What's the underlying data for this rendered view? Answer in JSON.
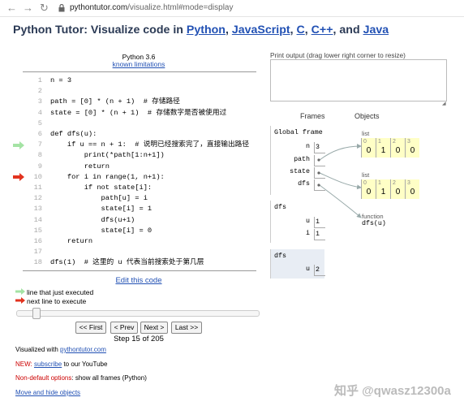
{
  "browser": {
    "url_host": "pythontutor.com",
    "url_path": "/visualize.html#mode=display"
  },
  "header": {
    "title_prefix": "Python Tutor: Visualize code in ",
    "lang_python": "Python",
    "lang_javascript": "JavaScript",
    "lang_c": "C",
    "lang_cpp": "C++",
    "and_text": ", and ",
    "comma": ", ",
    "lang_java": "Java"
  },
  "code_panel": {
    "version": "Python 3.6",
    "limitations_link": "known limitations",
    "lines": [
      {
        "num": "1",
        "text": "n = 3"
      },
      {
        "num": "2",
        "text": ""
      },
      {
        "num": "3",
        "text": "path = [0] * (n + 1)  # 存储路径"
      },
      {
        "num": "4",
        "text": "state = [0] * (n + 1)  # 存储数字是否被使用过"
      },
      {
        "num": "5",
        "text": ""
      },
      {
        "num": "6",
        "text": "def dfs(u):"
      },
      {
        "num": "7",
        "text": "    if u == n + 1:  # 说明已经搜索完了，直接输出路径"
      },
      {
        "num": "8",
        "text": "        print(*path[1:n+1])"
      },
      {
        "num": "9",
        "text": "        return"
      },
      {
        "num": "10",
        "text": "    for i in range(1, n+1):"
      },
      {
        "num": "11",
        "text": "        if not state[i]:"
      },
      {
        "num": "12",
        "text": "            path[u] = i"
      },
      {
        "num": "13",
        "text": "            state[i] = 1"
      },
      {
        "num": "14",
        "text": "            dfs(u+1)"
      },
      {
        "num": "15",
        "text": "            state[i] = 0"
      },
      {
        "num": "16",
        "text": "    return"
      },
      {
        "num": "17",
        "text": ""
      },
      {
        "num": "18",
        "text": "dfs(1)  # 这里的 u 代表当前搜索处于第几层"
      }
    ],
    "edit_link": "Edit this code",
    "legend_just_executed": "line that just executed",
    "legend_next_line": "next line to execute",
    "btn_first": "<< First",
    "btn_prev": "< Prev",
    "btn_next": "Next >",
    "btn_last": "Last >>",
    "step_text": "Step 15 of 205",
    "progress_fraction": 0.068,
    "colors": {
      "just_executed": "#a4e3a4",
      "next_line": "#e2331f"
    }
  },
  "footer": {
    "visualized_with": "Visualized with ",
    "site_link": "pythontutor.com",
    "new_label": "NEW: ",
    "subscribe_link": "subscribe",
    "youtube_text": " to our YouTube",
    "nondefault_label": "Non-default options",
    "nondefault_text": ": show all frames (Python)",
    "move_hide_link": "Move and hide objects"
  },
  "viz": {
    "print_output_label": "Print output (drag lower right corner to resize)",
    "frames_header": "Frames",
    "objects_header": "Objects",
    "global_frame": {
      "title": "Global frame",
      "vars": [
        {
          "name": "n",
          "value": "3"
        },
        {
          "name": "path",
          "value": ""
        },
        {
          "name": "state",
          "value": ""
        },
        {
          "name": "dfs",
          "value": ""
        }
      ]
    },
    "dfs_frame_1": {
      "title": "dfs",
      "vars": [
        {
          "name": "u",
          "value": "1"
        },
        {
          "name": "i",
          "value": "1"
        }
      ]
    },
    "dfs_frame_2": {
      "title": "dfs",
      "vars": [
        {
          "name": "u",
          "value": "2"
        }
      ]
    },
    "list_path": {
      "label": "list",
      "cells": [
        {
          "idx": "0",
          "val": "0"
        },
        {
          "idx": "1",
          "val": "1"
        },
        {
          "idx": "2",
          "val": "0"
        },
        {
          "idx": "3",
          "val": "0"
        }
      ]
    },
    "list_state": {
      "label": "list",
      "cells": [
        {
          "idx": "0",
          "val": "0"
        },
        {
          "idx": "1",
          "val": "1"
        },
        {
          "idx": "2",
          "val": "0"
        },
        {
          "idx": "3",
          "val": "0"
        }
      ]
    },
    "function_obj": {
      "label": "function",
      "sig": "dfs(u)"
    }
  },
  "watermark": "知乎 @qwasz12300a"
}
